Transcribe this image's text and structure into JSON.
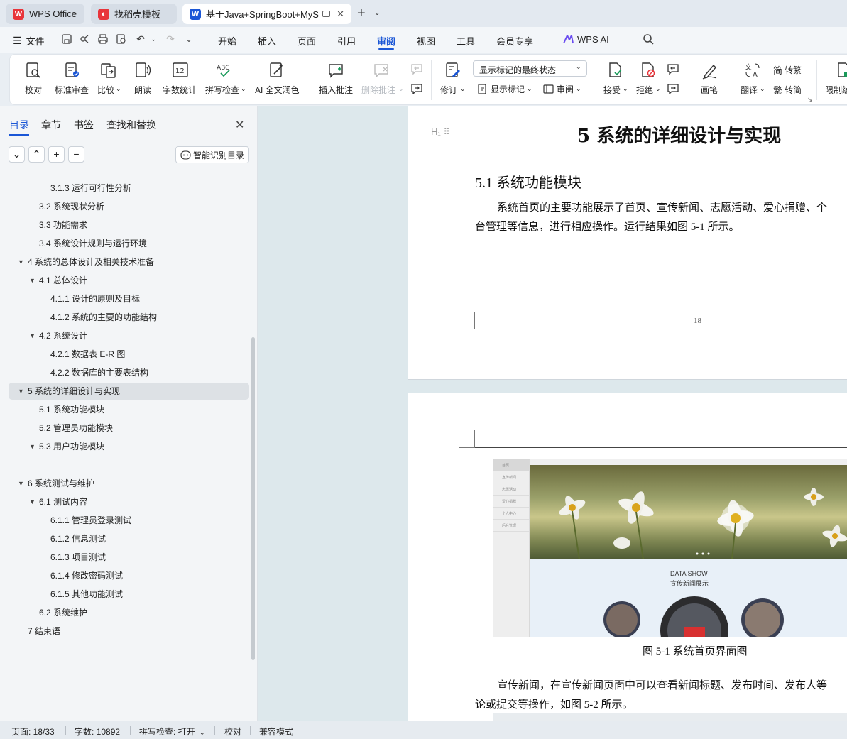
{
  "tabs": [
    {
      "label": "WPS Office",
      "icon": "wps-logo-icon"
    },
    {
      "label": "找稻壳模板",
      "icon": "docer-icon"
    },
    {
      "label": "基于Java+SpringBoot+MyS",
      "icon": "writer-doc-icon",
      "active": true
    }
  ],
  "menubar": {
    "file_label": "文件",
    "tabs": [
      "开始",
      "插入",
      "页面",
      "引用",
      "审阅",
      "视图",
      "工具",
      "会员专享",
      "WPS AI"
    ],
    "active_tab": "审阅"
  },
  "ribbon": {
    "proofread": "校对",
    "standard_review": "标准审查",
    "compare": "比较",
    "read_aloud": "朗读",
    "word_count": "字数统计",
    "spell_check": "拼写检查",
    "ai_polish": "AI 全文润色",
    "insert_comment": "插入批注",
    "delete_comment": "删除批注",
    "revise": "修订",
    "markup_select": "显示标记的最终状态",
    "show_markup": "显示标记",
    "review": "审阅",
    "accept": "接受",
    "reject": "拒绝",
    "pen": "画笔",
    "translate": "翻译",
    "to_traditional": "转繁",
    "to_simplified": "转简",
    "restrict": "限制编"
  },
  "panel": {
    "tabs": [
      "目录",
      "章节",
      "书签",
      "查找和替换"
    ],
    "active_tab": "目录",
    "smart_toc_label": "智能识别目录",
    "toc": [
      {
        "text": "3.1.3 运行可行性分析",
        "level": 3
      },
      {
        "text": "3.2  系统现状分析",
        "level": 2
      },
      {
        "text": "3.3 功能需求",
        "level": 2
      },
      {
        "text": "3.4 系统设计规则与运行环境",
        "level": 2
      },
      {
        "text": "4 系统的总体设计及相关技术准备",
        "level": 1,
        "expanded": true
      },
      {
        "text": "4.1 总体设计",
        "level": 2,
        "expanded": true
      },
      {
        "text": "4.1.1 设计的原则及目标",
        "level": 3
      },
      {
        "text": "4.1.2 系统的主要的功能结构",
        "level": 3
      },
      {
        "text": "4.2 系统设计",
        "level": 2,
        "expanded": true
      },
      {
        "text": "4.2.1 数据表 E-R 图",
        "level": 3
      },
      {
        "text": "4.2.2  数据库的主要表结构",
        "level": 3
      },
      {
        "text": "5 系统的详细设计与实现",
        "level": 1,
        "expanded": true,
        "selected": true
      },
      {
        "text": "5.1 系统功能模块",
        "level": 2
      },
      {
        "text": "5.2 管理员功能模块",
        "level": 2
      },
      {
        "text": "5.3 用户功能模块",
        "level": 2,
        "expanded": true
      },
      {
        "text": "",
        "level": 3
      },
      {
        "text": "6 系统测试与维护",
        "level": 1,
        "expanded": true
      },
      {
        "text": "6.1 测试内容",
        "level": 2,
        "expanded": true
      },
      {
        "text": "6.1.1 管理员登录测试",
        "level": 3
      },
      {
        "text": "6.1.2 信息测试",
        "level": 3
      },
      {
        "text": "6.1.3 项目测试",
        "level": 3
      },
      {
        "text": "6.1.4 修改密码测试",
        "level": 3
      },
      {
        "text": "6.1.5 其他功能测试",
        "level": 3
      },
      {
        "text": "6.2 系统维护",
        "level": 2
      },
      {
        "text": "7  结束语",
        "level": 1
      }
    ]
  },
  "document": {
    "heading1": "5 系统的详细设计与实现",
    "heading2": "5.1 系统功能模块",
    "para1_line1": "系统首页的主要功能展示了首页、宣传新闻、志愿活动、爱心捐赠、个",
    "para1_line2": "台管理等信息，进行相应操作。运行结果如图 5-1 所示。",
    "page_number": "18",
    "figure_caption": "图 5-1  系统首页界面图",
    "para2_line1": "宣传新闻，在宣传新闻页面中可以查看新闻标题、发布时间、发布人等",
    "para2_line2": "论或提交等操作，如图 5-2 所示。",
    "screenshot": {
      "nav": [
        "首页",
        "宣传新闻",
        "志愿活动",
        "爱心捐赠",
        "个人中心",
        "后台管理"
      ],
      "data_show": "DATA SHOW",
      "data_show_sub": "宣传新闻展示"
    }
  },
  "status": {
    "page": "页面: 18/33",
    "words": "字数: 10892",
    "spell": "拼写检查: 打开",
    "proof": "校对",
    "compat": "兼容模式"
  },
  "colors": {
    "accent": "#1a56d6",
    "wps_red": "#e8343a"
  }
}
